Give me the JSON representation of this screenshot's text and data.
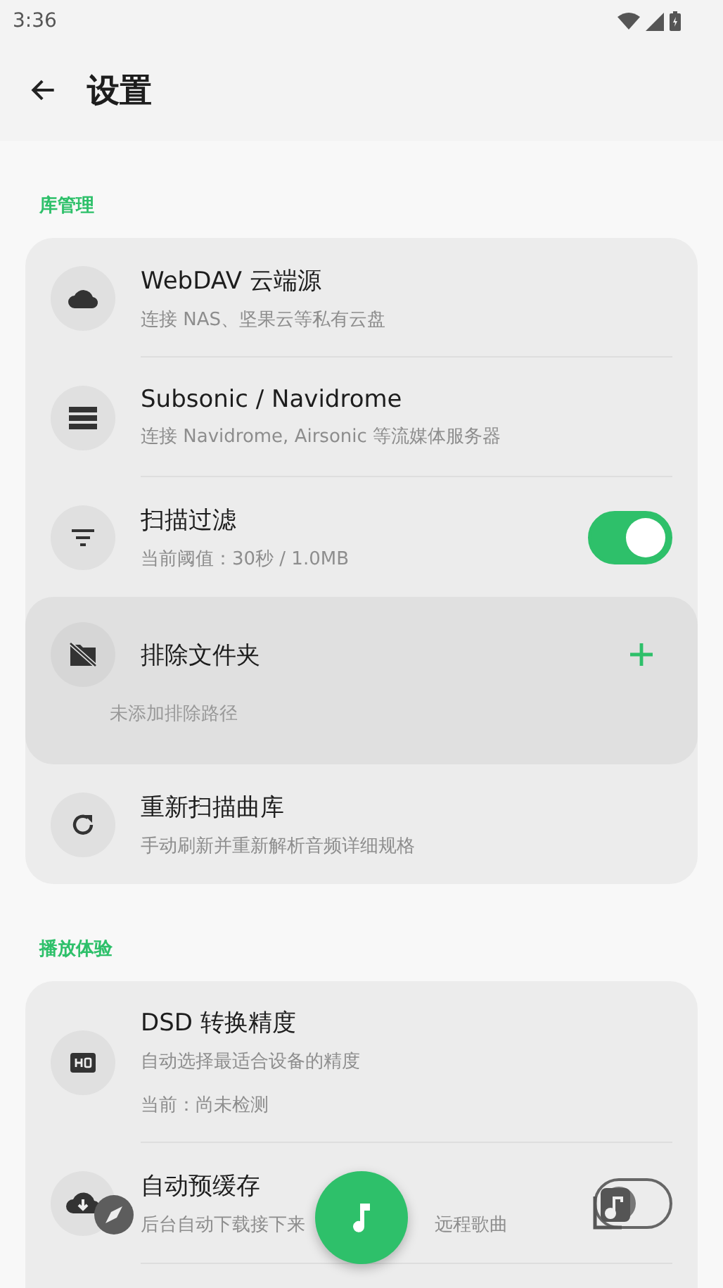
{
  "status_bar": {
    "time": "3:36"
  },
  "header": {
    "title": "设置"
  },
  "sections": [
    {
      "title": "库管理",
      "items": [
        {
          "kind": "link",
          "title": "WebDAV 云端源",
          "subtitle": "连接 NAS、坚果云等私有云盘"
        },
        {
          "kind": "link",
          "title": "Subsonic / Navidrome",
          "subtitle": "连接 Navidrome, Airsonic 等流媒体服务器"
        },
        {
          "kind": "toggle",
          "title": "扫描过滤",
          "subtitle": "当前阈值：30秒 / 1.0MB",
          "on": true
        },
        {
          "kind": "folders",
          "title": "排除文件夹",
          "note": "未添加排除路径",
          "expanded": true
        },
        {
          "kind": "link",
          "title": "重新扫描曲库",
          "subtitle": "手动刷新并重新解析音频详细规格"
        }
      ]
    },
    {
      "title": "播放体验",
      "items": [
        {
          "kind": "info",
          "title": "DSD 转换精度",
          "subtitle": "自动选择最适合设备的精度",
          "detail": "当前：尚未检测"
        },
        {
          "kind": "toggle",
          "title": "自动预缓存",
          "subtitle": "后台自动下载接下来",
          "subtitle_tail": "远程歌曲",
          "on": false
        }
      ]
    }
  ]
}
